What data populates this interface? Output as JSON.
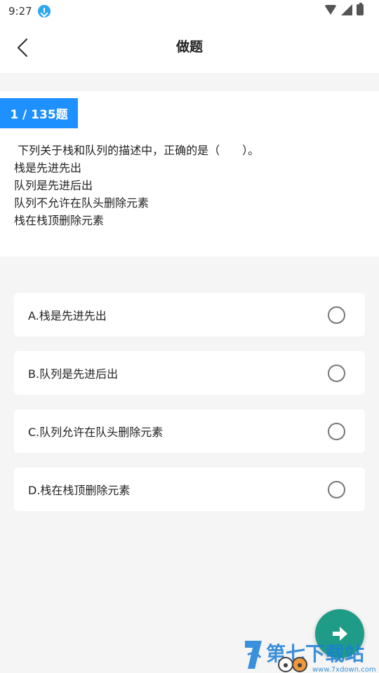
{
  "status_bar": {
    "time": "9:27",
    "icons": [
      "download-notification-icon",
      "wifi-icon",
      "signal-icon",
      "battery-icon"
    ]
  },
  "header": {
    "title": "做题",
    "back_icon": "chevron-left-icon"
  },
  "question": {
    "progress": "1 / 135题",
    "lines": [
      " 下列关于栈和队列的描述中，正确的是（　　）。",
      "栈是先进先出",
      "队列是先进后出",
      "队列不允许在队头删除元素",
      "栈在栈顶删除元素"
    ]
  },
  "options": [
    {
      "label": "A.栈是先进先出"
    },
    {
      "label": "B.队列是先进后出"
    },
    {
      "label": "C.队列允许在队头删除元素"
    },
    {
      "label": "D.栈在栈顶删除元素"
    }
  ],
  "next_button": {
    "icon": "arrow-right-icon"
  },
  "watermark": {
    "text": "第七下载站",
    "url_text": "www.7xdown.com"
  },
  "colors": {
    "accent": "#1e90ff",
    "fab": "#1f9c87",
    "background": "#f5f5f5"
  }
}
